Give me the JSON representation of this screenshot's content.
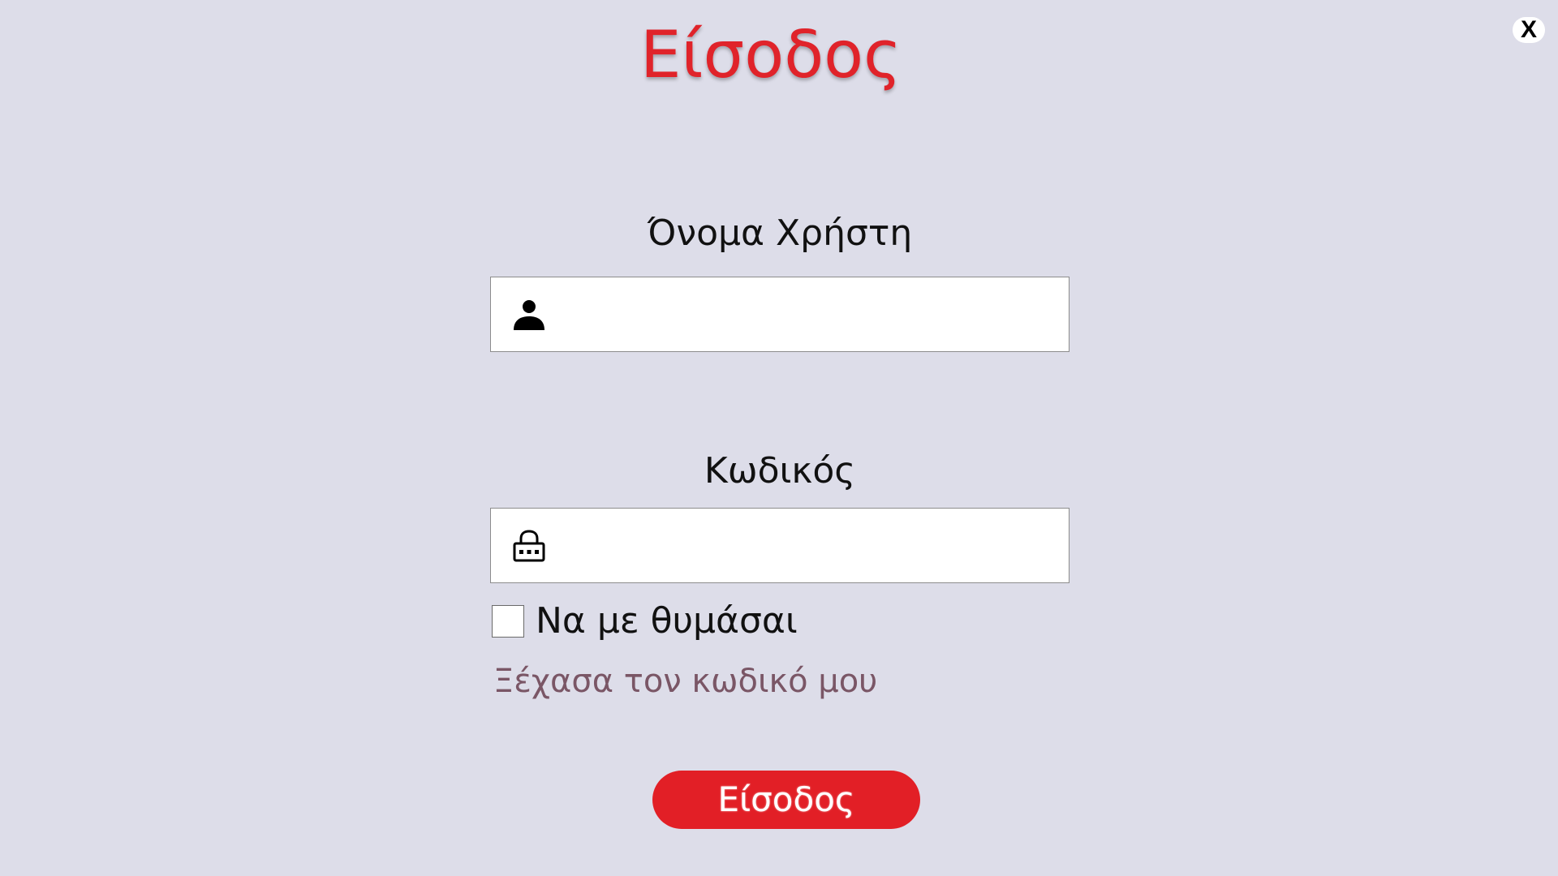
{
  "header": {
    "title": "Είσοδος",
    "close_label": "X"
  },
  "form": {
    "username": {
      "label": "Όνομα Χρήστη",
      "value": "",
      "placeholder": "",
      "icon": "user-icon"
    },
    "password": {
      "label": "Κωδικός",
      "value": "",
      "placeholder": "",
      "icon": "lock-icon"
    },
    "remember": {
      "label": "Να με θυμάσαι",
      "checked": false
    },
    "forgot_link": "Ξέχασα τον κωδικό μου",
    "submit_label": "Είσοδος"
  },
  "colors": {
    "background": "#dddde9",
    "accent": "#e21f26",
    "link": "#7a5666"
  }
}
